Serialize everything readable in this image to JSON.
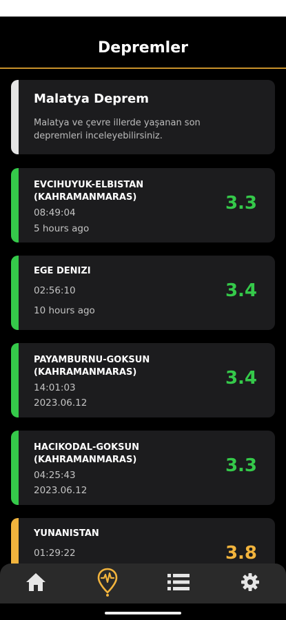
{
  "header": {
    "title": "Depremler"
  },
  "intro": {
    "title": "Malatya Deprem",
    "description": "Malatya ve çevre illerde yaşanan son depremleri inceleyebilirsiniz."
  },
  "earthquakes": [
    {
      "place": "EVCIHUYUK-ELBISTAN (KAHRAMANMARAS)",
      "time": "08:49:04",
      "ago": "5 hours ago",
      "magnitude": "3.3",
      "level": "green"
    },
    {
      "place": "EGE DENIZI",
      "time": "02:56:10",
      "ago": "10 hours ago",
      "magnitude": "3.4",
      "level": "green"
    },
    {
      "place": "PAYAMBURNU-GOKSUN (KAHRAMANMARAS)",
      "time": "14:01:03",
      "ago": "2023.06.12",
      "magnitude": "3.4",
      "level": "green"
    },
    {
      "place": "HACIKODAL-GOKSUN (KAHRAMANMARAS)",
      "time": "04:25:43",
      "ago": "2023.06.12",
      "magnitude": "3.3",
      "level": "green"
    },
    {
      "place": "YUNANISTAN",
      "time": "01:29:22",
      "ago": "",
      "magnitude": "3.8",
      "level": "yellow"
    }
  ],
  "colors": {
    "accent": "#c9922b",
    "low": "#35c94a",
    "medium": "#f2b43d",
    "nav_active": "#f2b43d",
    "nav_inactive": "#e6e6e6"
  },
  "nav": [
    {
      "icon": "home-icon",
      "active": false
    },
    {
      "icon": "seismic-pin-icon",
      "active": true
    },
    {
      "icon": "list-icon",
      "active": false
    },
    {
      "icon": "gear-icon",
      "active": false
    }
  ]
}
